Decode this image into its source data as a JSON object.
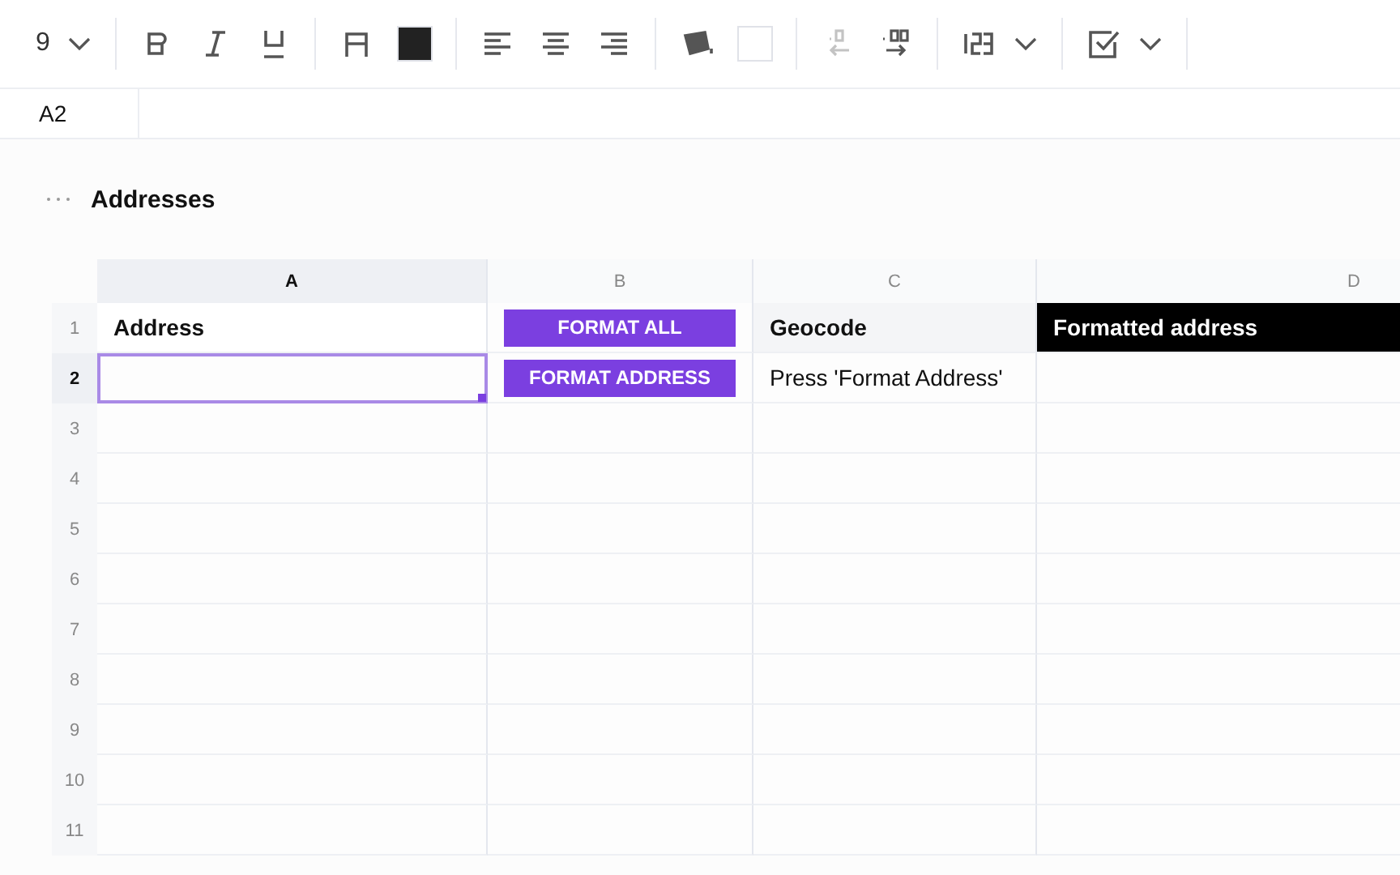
{
  "toolbar": {
    "font_size": "9",
    "text_color": {
      "color": "#222222"
    },
    "fill_color": {
      "color": "#ffffff"
    },
    "decrease_decimals": {
      "disabled": true
    },
    "increase_decimals": {
      "disabled": false
    }
  },
  "formula_bar": {
    "cell_ref": "A2"
  },
  "sheet": {
    "title": "Addresses"
  },
  "columns": [
    {
      "label": "A",
      "selected": true
    },
    {
      "label": "B",
      "selected": false
    },
    {
      "label": "C",
      "selected": false
    },
    {
      "label": "D",
      "selected": false
    }
  ],
  "rows": [
    {
      "label": "1",
      "selected": false,
      "cells": [
        {
          "kind": "header",
          "text": "Address",
          "selected": false
        },
        {
          "kind": "button",
          "text": "FORMAT ALL",
          "selected": false
        },
        {
          "kind": "header",
          "text": "Geocode",
          "selected": false
        },
        {
          "kind": "dark",
          "text": "Formatted address",
          "selected": false
        }
      ]
    },
    {
      "label": "2",
      "selected": true,
      "cells": [
        {
          "kind": "text",
          "selected": true
        },
        {
          "kind": "button",
          "text": "FORMAT ADDRESS",
          "selected": false
        },
        {
          "kind": "text",
          "text": "Press 'Format Address'",
          "selected": false
        },
        {
          "kind": "text",
          "selected": false
        }
      ]
    },
    {
      "label": "3",
      "selected": false
    },
    {
      "label": "4",
      "selected": false
    },
    {
      "label": "5",
      "selected": false
    },
    {
      "label": "6",
      "selected": false
    },
    {
      "label": "7",
      "selected": false
    },
    {
      "label": "8",
      "selected": false
    },
    {
      "label": "9",
      "selected": false
    },
    {
      "label": "10",
      "selected": false
    },
    {
      "label": "11",
      "selected": false
    }
  ]
}
